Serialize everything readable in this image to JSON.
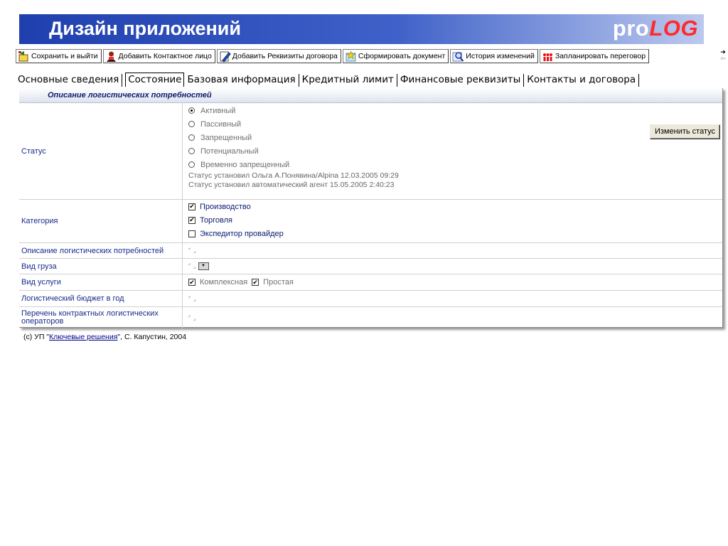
{
  "header": {
    "title": "Дизайн приложений",
    "logo_pro": "pro",
    "logo_log": "LOG"
  },
  "toolbar": {
    "buttons": [
      {
        "label": "Сохранить и выйти",
        "icon": "save-exit-icon"
      },
      {
        "label": "Добавить Контактное лицо",
        "icon": "contact-person-icon"
      },
      {
        "label": "Добавить Реквизиты договора",
        "icon": "contract-edit-icon"
      },
      {
        "label": "Сформировать документ",
        "icon": "create-document-icon"
      },
      {
        "label": "История изменений",
        "icon": "history-search-icon"
      },
      {
        "label": "Запланировать переговор",
        "icon": "meeting-people-icon"
      }
    ]
  },
  "tabs": [
    {
      "label": "Основные сведения"
    },
    {
      "label": "Состояние",
      "active": true
    },
    {
      "label": "Базовая информация"
    },
    {
      "label": "Кредитный лимит"
    },
    {
      "label": "Финансовые реквизиты"
    },
    {
      "label": "Контакты и договора"
    }
  ],
  "form": {
    "section_title": "Описание логистических потребностей",
    "status": {
      "label": "Статус",
      "options": [
        "Активный",
        "Пассивный",
        "Запрещенный",
        "Потенциальный",
        "Временно запрещенный"
      ],
      "selected": "Активный",
      "notes": [
        "Статус установил Ольга А.Понявина/Alpina 12.03.2005 09:29",
        "Статус установил автоматический агент 15.05.2005 2:40:23"
      ],
      "change_button": "Изменить статус"
    },
    "category": {
      "label": "Категория",
      "options": [
        {
          "label": "Производство",
          "checked": true
        },
        {
          "label": "Торговля",
          "checked": true
        },
        {
          "label": "Экспедитор провайдер",
          "checked": false
        }
      ]
    },
    "logistics_description": {
      "label": "Описание логистических потребностей"
    },
    "cargo_type": {
      "label": "Вид груза"
    },
    "service_type": {
      "label": "Вид услуги",
      "options": [
        {
          "label": "Комплексная",
          "checked": true
        },
        {
          "label": "Простая",
          "checked": true
        }
      ]
    },
    "budget": {
      "label": "Логистический бюджет в год"
    },
    "operators": {
      "label": "Перечень контрактных логистических операторов"
    }
  },
  "footer": {
    "prefix": "(c) УП \"",
    "link": "Ключевые решения",
    "suffix": "\", С. Капустин, 2004"
  }
}
